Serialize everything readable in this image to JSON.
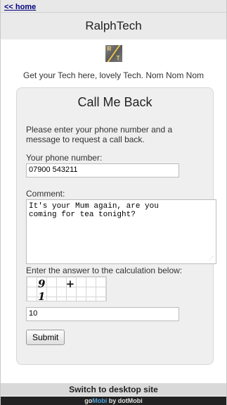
{
  "nav": {
    "home_label": "<< home"
  },
  "header": {
    "site_title": "RalphTech"
  },
  "logo": {
    "letter_r": "R",
    "letter_t": "T"
  },
  "tagline": "Get your Tech here, lovely Tech. Nom Nom Nom",
  "form": {
    "title": "Call Me Back",
    "intro": "Please enter your phone number and a message to request a call back.",
    "phone_label": "Your phone number:",
    "phone_value": "07900 543211",
    "comment_label": "Comment:",
    "comment_value": "It's your Mum again, are you\ncoming for tea tonight?",
    "captcha_label": "Enter the answer to the calculation below:",
    "captcha_text": "9 + 1",
    "answer_value": "10",
    "submit_label": "Submit"
  },
  "footer": {
    "switch_label": "Switch to desktop site",
    "powered_prefix": "go",
    "powered_accent": "Mobi",
    "powered_suffix": " by dotMobi"
  },
  "colors": {
    "link": "#000080",
    "accent": "#4fa7e0"
  }
}
